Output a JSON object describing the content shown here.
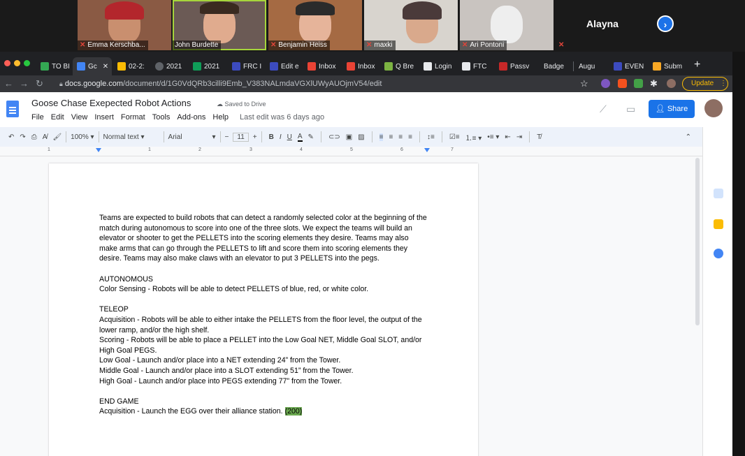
{
  "meeting": {
    "participants": [
      {
        "name": "Emma Kerschba..."
      },
      {
        "name": "John Burdette"
      },
      {
        "name": "Benjamin Heiss"
      },
      {
        "name": "maxki"
      },
      {
        "name": "Ari Pontoni"
      }
    ],
    "overflow_name": "Alayna",
    "next_icon": "chevron-right-icon"
  },
  "browser": {
    "tabs": [
      "TO BI",
      "Gc",
      "02-2:",
      "2021",
      "2021",
      "FRC I",
      "Edit e",
      "Inbox",
      "Inbox",
      "Q Bre",
      "Login",
      "FTC",
      "Passv",
      "Badgе",
      "Augu",
      "EVEN",
      "Subm"
    ],
    "url_host": "docs.google.com",
    "url_path": "/document/d/1G0VdQRb3cilli9Emb_V383NALmdaVGXlUWyAUOjmV54/edit",
    "update_label": "Update"
  },
  "docs": {
    "title": "Goose Chase Exepected Robot Actions",
    "saved": "Saved to Drive",
    "menu": [
      "File",
      "Edit",
      "View",
      "Insert",
      "Format",
      "Tools",
      "Add-ons",
      "Help"
    ],
    "last_edit": "Last edit was 6 days ago",
    "share_label": "Share",
    "zoom": "100%",
    "style": "Normal text",
    "font": "Arial",
    "font_size": "11",
    "ruler_numbers": [
      "1",
      "1",
      "2",
      "3",
      "4",
      "5",
      "6",
      "7"
    ]
  },
  "document": {
    "intro": "Teams are expected to build robots that can detect a randomly selected color at the beginning of the match during autonomous to score into one of the three slots. We expect the teams will build an elevator or shooter to get the PELLETS into the scoring elements they desire.  Teams may also make arms that can go through the PELLETS to lift and score them into scoring elements they desire. Teams may also make claws with an elevator to put 3 PELLETS into the pegs.",
    "autonomous_heading": "AUTONOMOUS",
    "autonomous_line": "Color Sensing - Robots will be able to detect PELLETS of blue, red, or white color.",
    "teleop_heading": "TELEOP",
    "teleop_acquisition": "Acquisition - Robots will be able to either intake the PELLETS from the floor level, the output of the lower ramp, and/or the high shelf.",
    "teleop_scoring": "Scoring - Robots will be able to place a PELLET into the Low Goal NET, Middle Goal SLOT, and/or High Goal PEGS.",
    "low_goal": "Low Goal - Launch and/or place into a NET extending 24” from the Tower.",
    "middle_goal": "Middle Goal - Launch and/or place into a SLOT extending 51” from the Tower.",
    "high_goal": "High Goal - Launch and/or place into PEGS extending 77” from the Tower.",
    "endgame_heading": "END GAME",
    "endgame_line": "Acquisition - Launch the EGG over their alliance station.",
    "endgame_points": "(200)",
    "highlight_color": "#6aa84f"
  }
}
